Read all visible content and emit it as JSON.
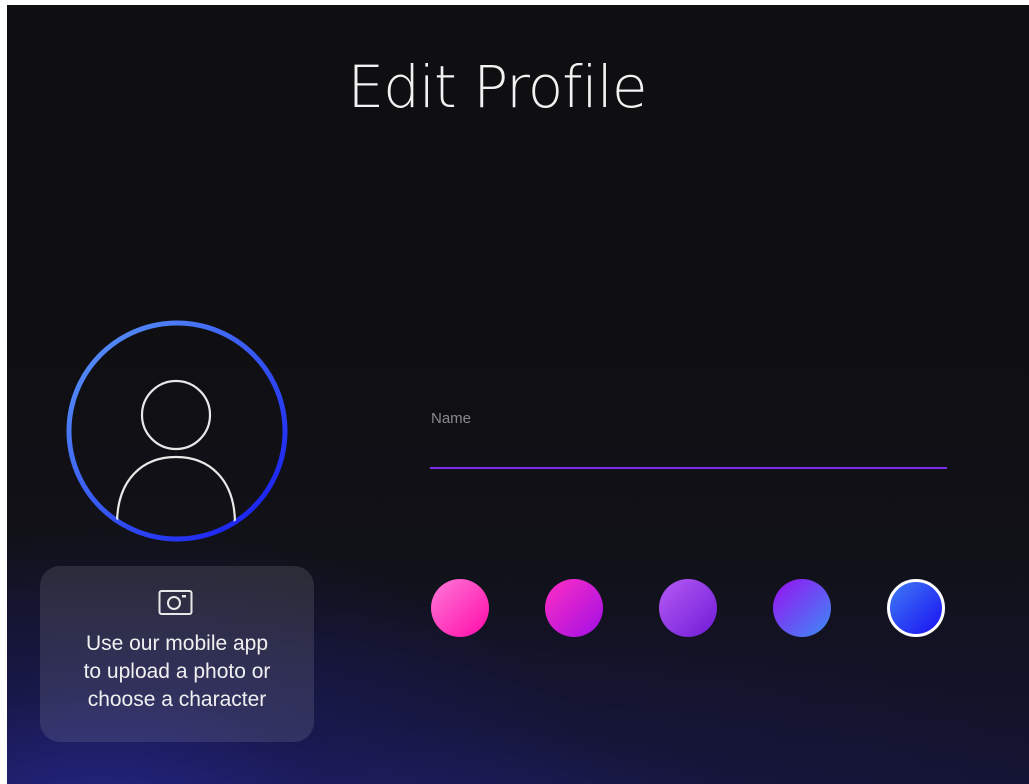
{
  "page": {
    "title": "Edit Profile"
  },
  "avatar": {
    "icon": "person-icon",
    "ring_colors": [
      "#4f8ef5",
      "#1a1ef2"
    ]
  },
  "upload_card": {
    "icon": "camera-icon",
    "text": "Use our mobile app\nto upload a photo or\nchoose a character"
  },
  "name_field": {
    "label": "Name",
    "value": "",
    "underline_color": "#7b2ee8"
  },
  "color_swatches": [
    {
      "name": "pink",
      "from": "#ff7ad9",
      "to": "#ff0aa8",
      "selected": false
    },
    {
      "name": "magenta",
      "from": "#ff2ec4",
      "to": "#a10fe6",
      "selected": false
    },
    {
      "name": "purple",
      "from": "#b65cf5",
      "to": "#6e1ad6",
      "selected": false
    },
    {
      "name": "violet-blue",
      "from": "#9a10f2",
      "to": "#3a8df5",
      "selected": false
    },
    {
      "name": "blue",
      "from": "#3e7bf7",
      "to": "#1a0ff0",
      "selected": true
    }
  ]
}
